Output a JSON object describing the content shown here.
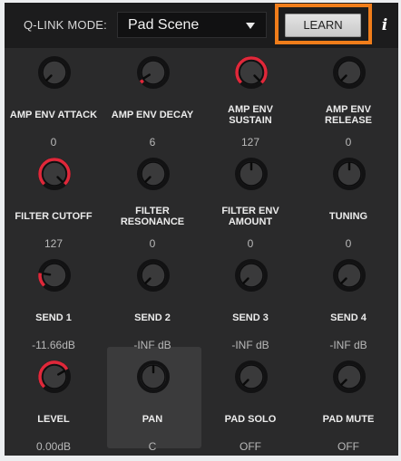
{
  "header": {
    "mode_label": "Q-LINK MODE:",
    "mode_value": "Pad Scene",
    "learn_label": "LEARN",
    "info_label": "i"
  },
  "colors": {
    "accent": "#e0283a",
    "highlight": "#f07d1a"
  },
  "knobs": [
    {
      "label": "AMP ENV ATTACK",
      "value": "0",
      "level": 0.0
    },
    {
      "label": "AMP ENV DECAY",
      "value": "6",
      "level": 0.05
    },
    {
      "label": "AMP ENV SUSTAIN",
      "value": "127",
      "level": 1.0
    },
    {
      "label": "AMP ENV RELEASE",
      "value": "0",
      "level": 0.0
    },
    {
      "label": "FILTER CUTOFF",
      "value": "127",
      "level": 1.0
    },
    {
      "label": "FILTER RESONANCE",
      "value": "0",
      "level": 0.0
    },
    {
      "label": "FILTER ENV AMOUNT",
      "value": "0",
      "level": 0.5,
      "bipolar": true
    },
    {
      "label": "TUNING",
      "value": "0",
      "level": 0.5,
      "bipolar": true
    },
    {
      "label": "SEND 1",
      "value": "-11.66dB",
      "level": 0.2
    },
    {
      "label": "SEND 2",
      "value": "-INF dB",
      "level": 0.0
    },
    {
      "label": "SEND 3",
      "value": "-INF dB",
      "level": 0.0
    },
    {
      "label": "SEND 4",
      "value": "-INF dB",
      "level": 0.0
    },
    {
      "label": "LEVEL",
      "value": "0.00dB",
      "level": 0.72
    },
    {
      "label": "PAN",
      "value": "C",
      "level": 0.5,
      "bipolar": true
    },
    {
      "label": "PAD SOLO",
      "value": "OFF",
      "level": 0.0
    },
    {
      "label": "PAD MUTE",
      "value": "OFF",
      "level": 0.0
    }
  ]
}
